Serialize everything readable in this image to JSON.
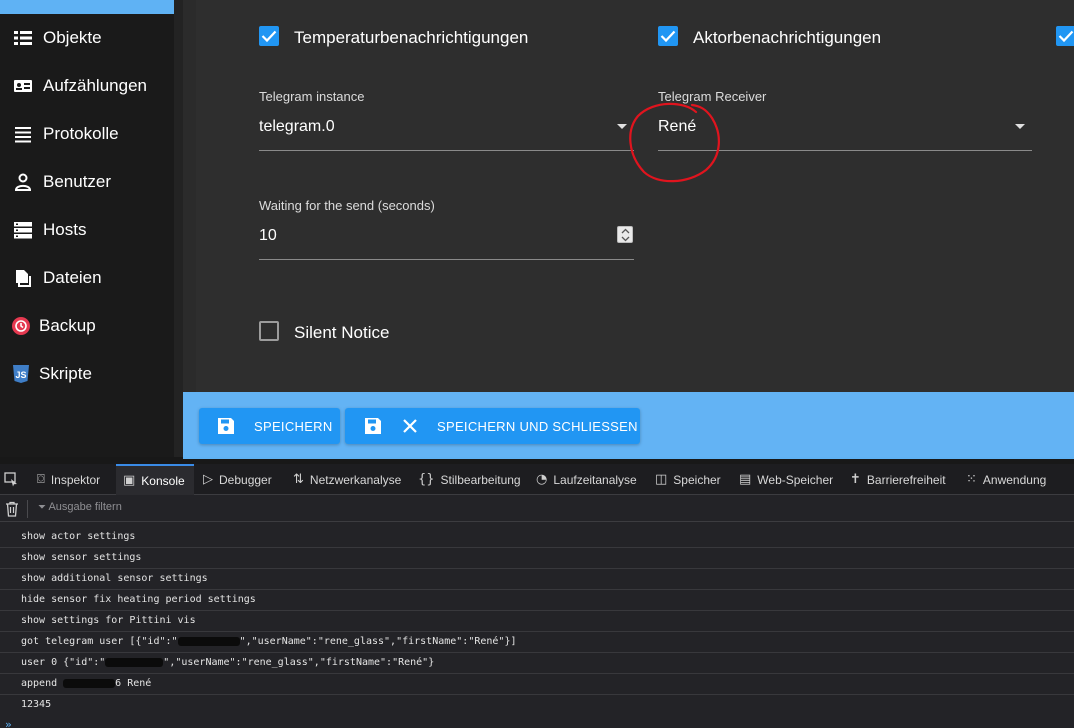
{
  "sidebar": {
    "items": [
      {
        "label": "Objekte",
        "icon": "list-icon"
      },
      {
        "label": "Aufzählungen",
        "icon": "badge-icon"
      },
      {
        "label": "Protokolle",
        "icon": "lines-icon"
      },
      {
        "label": "Benutzer",
        "icon": "person-icon"
      },
      {
        "label": "Hosts",
        "icon": "server-icon"
      },
      {
        "label": "Dateien",
        "icon": "files-icon"
      },
      {
        "label": "Backup",
        "icon": "backup-icon"
      },
      {
        "label": "Skripte",
        "icon": "js-icon"
      }
    ]
  },
  "settings": {
    "temp_notifications": {
      "label": "Temperaturbenachrichtigungen",
      "checked": true
    },
    "actor_notifications": {
      "label": "Aktorbenachrichtigungen",
      "checked": true
    },
    "telegram_instance": {
      "label": "Telegram instance",
      "value": "telegram.0"
    },
    "telegram_receiver": {
      "label": "Telegram Receiver",
      "value": "René"
    },
    "waiting": {
      "label": "Waiting for the send (seconds)",
      "value": "10"
    },
    "silent_notice": {
      "label": "Silent Notice",
      "checked": false
    }
  },
  "buttons": {
    "save": "SPEICHERN",
    "save_close": "SPEICHERN UND SCHLIESSEN"
  },
  "devtools": {
    "tabs": [
      {
        "label": "Inspektor",
        "icon": "⌼"
      },
      {
        "label": "Konsole",
        "icon": "▣"
      },
      {
        "label": "Debugger",
        "icon": "▷"
      },
      {
        "label": "Netzwerkanalyse",
        "icon": "⇅"
      },
      {
        "label": "Stilbearbeitung",
        "icon": "{}"
      },
      {
        "label": "Laufzeitanalyse",
        "icon": "◔"
      },
      {
        "label": "Speicher",
        "icon": "◫"
      },
      {
        "label": "Web-Speicher",
        "icon": "▤"
      },
      {
        "label": "Barrierefreiheit",
        "icon": "✝"
      },
      {
        "label": "Anwendung",
        "icon": "⁙"
      }
    ],
    "active_tab": "Konsole",
    "filter_placeholder": "Ausgabe filtern",
    "logs": {
      "l1": "show actor settings",
      "l2": "show sensor settings",
      "l3": "show additional sensor settings",
      "l4": "hide sensor fix heating period settings",
      "l5": "show settings for Pittini vis",
      "l6a": "got telegram user [{\"id\":\"",
      "l6b": "\",\"userName\":\"rene_glass\",\"firstName\":\"René\"}]",
      "l7a": "user 0 {\"id\":\"",
      "l7b": "\",\"userName\":\"rene_glass\",\"firstName\":\"René\"}",
      "l8a": "append ",
      "l8b": "6 René",
      "l9": "12345"
    },
    "prompt": "»"
  },
  "colors": {
    "accent": "#2196f3",
    "bar": "#63b3f4",
    "annotation": "#e0141e"
  }
}
